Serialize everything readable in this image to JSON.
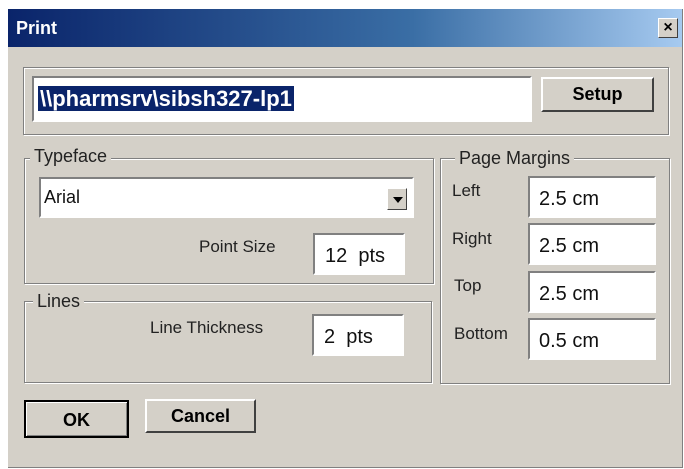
{
  "dialog": {
    "title": "Print",
    "close_label": "×"
  },
  "printer": {
    "name": "\\\\pharmsrv\\sibsh327-lp1",
    "setup_label": "Setup"
  },
  "typeface": {
    "group_label": "Typeface",
    "font_value": "Arial",
    "point_size_label": "Point Size",
    "point_size_value": "12  pts"
  },
  "lines": {
    "group_label": "Lines",
    "thickness_label": "Line Thickness",
    "thickness_value": "2  pts"
  },
  "margins": {
    "group_label": "Page Margins",
    "left_label": "Left",
    "left_value": "2.5 cm",
    "right_label": "Right",
    "right_value": "2.5 cm",
    "top_label": "Top",
    "top_value": "2.5 cm",
    "bottom_label": "Bottom",
    "bottom_value": "0.5 cm"
  },
  "buttons": {
    "ok_label": "OK",
    "cancel_label": "Cancel"
  }
}
